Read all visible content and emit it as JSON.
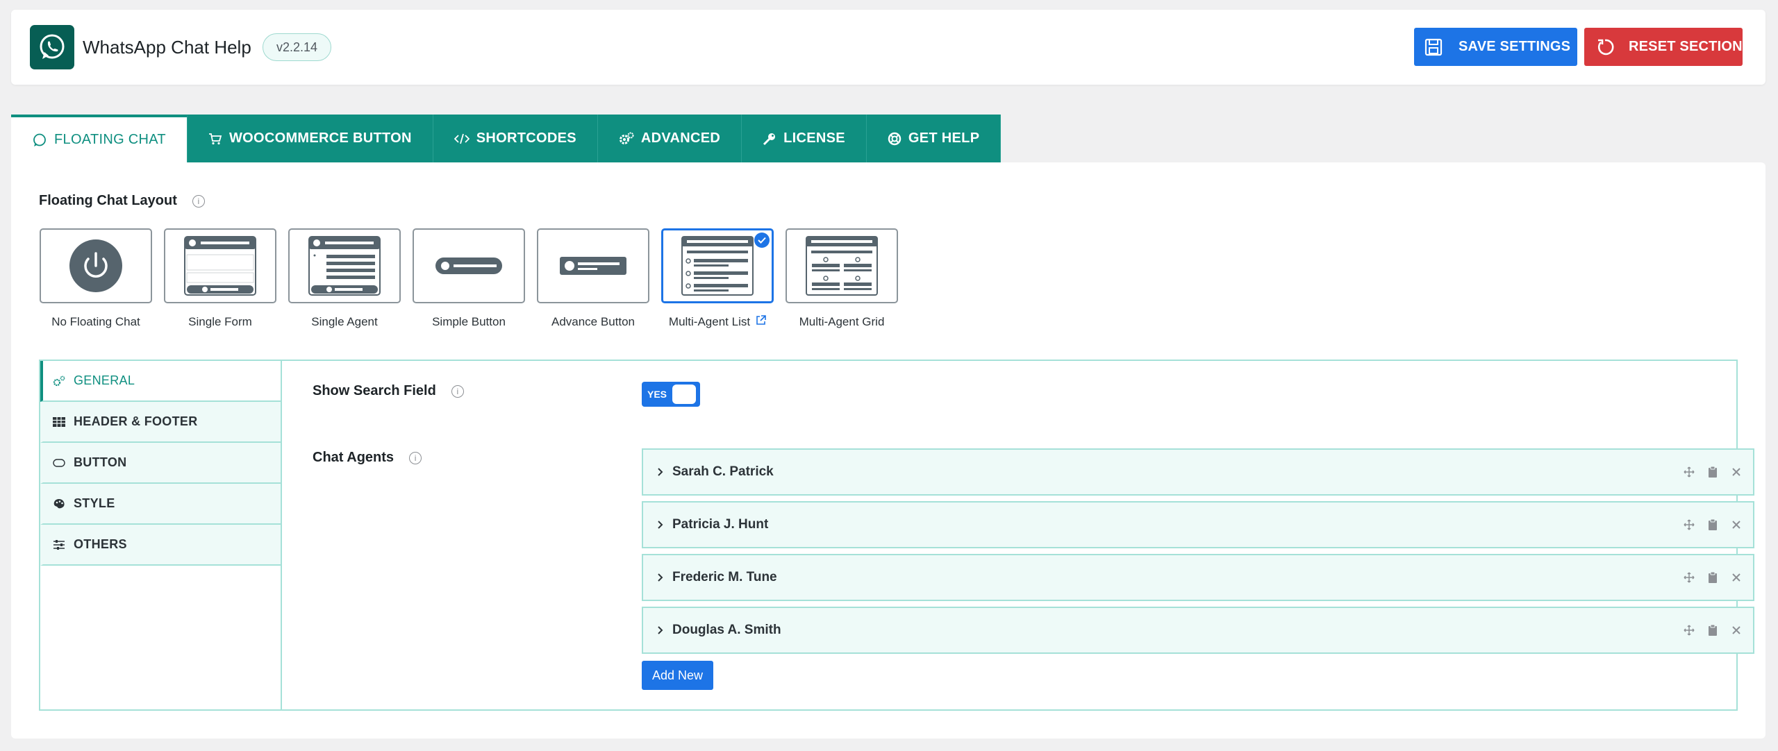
{
  "header": {
    "app_title": "WhatsApp Chat Help",
    "version": "v2.2.14",
    "save_label": "SAVE SETTINGS",
    "reset_label": "RESET SECTION"
  },
  "colors": {
    "brand": "#075e54",
    "accent": "#0f8f80",
    "primary": "#1d74e6",
    "danger": "#d8393c"
  },
  "tabs": [
    {
      "label": "FLOATING CHAT",
      "icon": "whatsapp-icon",
      "active": true
    },
    {
      "label": "WOOCOMMERCE BUTTON",
      "icon": "cart-icon"
    },
    {
      "label": "SHORTCODES",
      "icon": "code-icon"
    },
    {
      "label": "ADVANCED",
      "icon": "gears-icon"
    },
    {
      "label": "LICENSE",
      "icon": "key-icon"
    },
    {
      "label": "GET HELP",
      "icon": "lifebuoy-icon"
    }
  ],
  "layout": {
    "label": "Floating Chat Layout",
    "options": [
      {
        "label": "No Floating Chat"
      },
      {
        "label": "Single Form"
      },
      {
        "label": "Single Agent"
      },
      {
        "label": "Simple Button"
      },
      {
        "label": "Advance Button"
      },
      {
        "label": "Multi-Agent List",
        "selected": true
      },
      {
        "label": "Multi-Agent Grid"
      }
    ]
  },
  "sidenav": [
    {
      "label": "GENERAL",
      "icon": "gears-icon",
      "active": true
    },
    {
      "label": "HEADER & FOOTER",
      "icon": "table-icon"
    },
    {
      "label": "BUTTON",
      "icon": "button-icon"
    },
    {
      "label": "STYLE",
      "icon": "palette-icon"
    },
    {
      "label": "OTHERS",
      "icon": "sliders-icon"
    }
  ],
  "general": {
    "search_label": "Show Search Field",
    "search_toggle": "YES",
    "agents_label": "Chat Agents",
    "agents": [
      "Sarah C. Patrick",
      "Patricia J. Hunt",
      "Frederic M. Tune",
      "Douglas A. Smith"
    ],
    "add_new_label": "Add New"
  }
}
